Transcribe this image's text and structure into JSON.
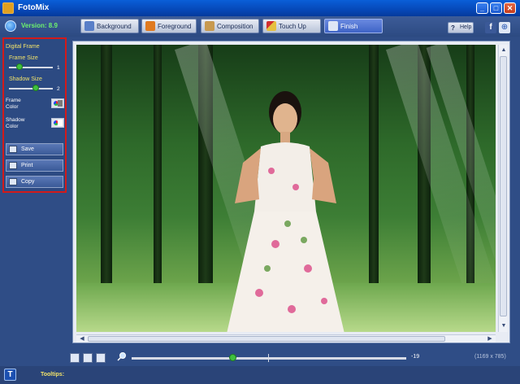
{
  "window": {
    "title": "FotoMix"
  },
  "header": {
    "version": "Version: 8.9",
    "tabs": [
      {
        "label": "Background",
        "icon": "background-icon",
        "active": false
      },
      {
        "label": "Foreground",
        "icon": "foreground-icon",
        "active": false
      },
      {
        "label": "Composition",
        "icon": "composition-icon",
        "active": false
      },
      {
        "label": "Touch Up",
        "icon": "touchup-icon",
        "active": false
      },
      {
        "label": "Finish",
        "icon": "finish-icon",
        "active": true
      }
    ],
    "help_label": "Help"
  },
  "panel": {
    "title": "Digital Frame",
    "frame_size": {
      "label": "Frame Size",
      "value": "1",
      "level": 0.1
    },
    "shadow_size": {
      "label": "Shadow Size",
      "value": "2",
      "level": 0.6
    },
    "frame_color": {
      "label_line1": "Frame",
      "label_line2": "Color",
      "color": "#7a7a7a"
    },
    "shadow_color": {
      "label_line1": "Shadow",
      "label_line2": "Color",
      "color": "#ffffff"
    },
    "buttons": {
      "save": "Save",
      "print": "Print",
      "copy": "Copy"
    }
  },
  "zoom": {
    "value": "-19",
    "dimensions": "(1169 x 785)",
    "level": 0.36
  },
  "status": {
    "tooltips_label": "Tooltips:"
  },
  "colors": {
    "accent": "#3e63c6",
    "panel_border": "#d21a1a",
    "label_yellow": "#f2e36a"
  }
}
